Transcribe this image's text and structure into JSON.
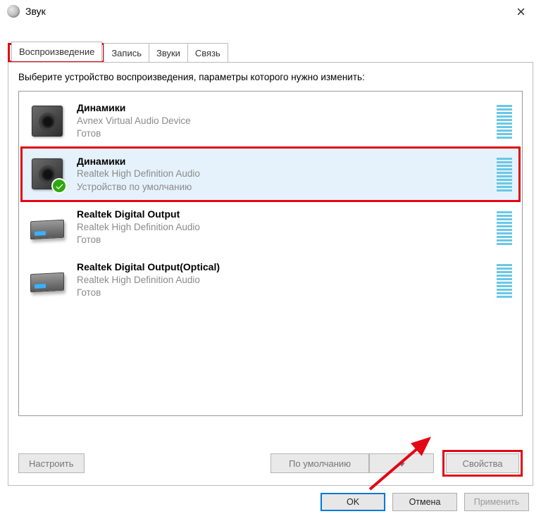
{
  "window": {
    "title": "Звук"
  },
  "tabs": [
    {
      "label": "Воспроизведение"
    },
    {
      "label": "Запись"
    },
    {
      "label": "Звуки"
    },
    {
      "label": "Связь"
    }
  ],
  "panel": {
    "instruction": "Выберите устройство воспроизведения, параметры которого нужно изменить:"
  },
  "devices": [
    {
      "name": "Динамики",
      "driver": "Avnex Virtual Audio Device",
      "status": "Готов",
      "type": "speaker",
      "default": false,
      "selected": false
    },
    {
      "name": "Динамики",
      "driver": "Realtek High Definition Audio",
      "status": "Устройство по умолчанию",
      "type": "speaker",
      "default": true,
      "selected": true
    },
    {
      "name": "Realtek Digital Output",
      "driver": "Realtek High Definition Audio",
      "status": "Готов",
      "type": "digital",
      "default": false,
      "selected": false
    },
    {
      "name": "Realtek Digital Output(Optical)",
      "driver": "Realtek High Definition Audio",
      "status": "Готов",
      "type": "digital",
      "default": false,
      "selected": false
    }
  ],
  "buttons": {
    "configure": "Настроить",
    "default": "По умолчанию",
    "properties": "Свойства",
    "ok": "OK",
    "cancel": "Отмена",
    "apply": "Применить"
  },
  "colors": {
    "highlight": "#e30613",
    "selection": "#e6f2fb",
    "accent": "#0078d7"
  }
}
